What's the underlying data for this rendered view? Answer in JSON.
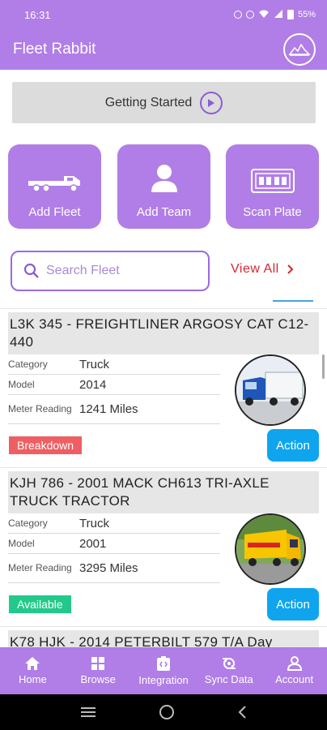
{
  "status_bar": {
    "time": "16:31",
    "battery": "55%"
  },
  "app_bar": {
    "title": "Fleet Rabbit",
    "logo_icon": "fleet-rabbit-logo"
  },
  "getting_started": {
    "label": "Getting Started"
  },
  "tiles": [
    {
      "label": "Add Fleet",
      "icon": "truck-icon"
    },
    {
      "label": "Add Team",
      "icon": "person-icon"
    },
    {
      "label": "Scan Plate",
      "icon": "license-plate-icon"
    }
  ],
  "search": {
    "placeholder": "Search Fleet",
    "value": ""
  },
  "view_all": {
    "label": "View All"
  },
  "fleet": [
    {
      "title": "L3K 345 - FREIGHTLINER ARGOSY CAT C12-440",
      "category_label": "Category",
      "category": "Truck",
      "model_label": "Model",
      "model": "2014",
      "meter_label": "Meter Reading",
      "meter": "1241 Miles",
      "status": "Breakdown",
      "status_color": "#ee5f63",
      "action": "Action"
    },
    {
      "title": "KJH 786 - 2001 MACK CH613 TRI-AXLE TRUCK TRACTOR",
      "category_label": "Category",
      "category": "Truck",
      "model_label": "Model",
      "model": "2001",
      "meter_label": "Meter Reading",
      "meter": "3295 Miles",
      "status": "Available",
      "status_color": "#23c98a",
      "action": "Action"
    },
    {
      "title": "K78 HJK - 2014 PETERBILT 579 T/A Day"
    }
  ],
  "bottom_nav": [
    {
      "label": "Home",
      "icon": "home-icon"
    },
    {
      "label": "Browse",
      "icon": "grid-icon"
    },
    {
      "label": "Integration",
      "icon": "integration-icon"
    },
    {
      "label": "Sync Data",
      "icon": "sync-icon"
    },
    {
      "label": "Account",
      "icon": "account-icon"
    }
  ],
  "colors": {
    "primary": "#b07ee6",
    "accent_red": "#d7262e",
    "action_blue": "#0ea5ee"
  }
}
